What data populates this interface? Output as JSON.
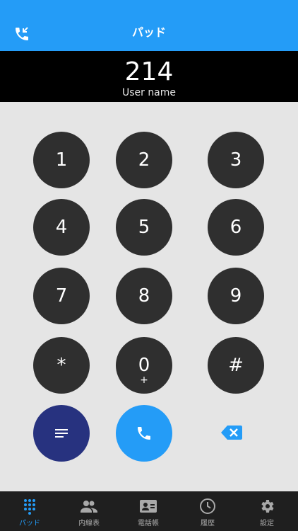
{
  "header": {
    "title": "パッド",
    "left_icon": "incoming-call-icon"
  },
  "display": {
    "number": "214",
    "user_name": "User name"
  },
  "keypad": {
    "keys": [
      {
        "digit": "1",
        "sub": ""
      },
      {
        "digit": "2",
        "sub": ""
      },
      {
        "digit": "3",
        "sub": ""
      },
      {
        "digit": "4",
        "sub": ""
      },
      {
        "digit": "5",
        "sub": ""
      },
      {
        "digit": "6",
        "sub": ""
      },
      {
        "digit": "7",
        "sub": ""
      },
      {
        "digit": "8",
        "sub": ""
      },
      {
        "digit": "9",
        "sub": ""
      },
      {
        "digit": "*",
        "sub": ""
      },
      {
        "digit": "0",
        "sub": "+"
      },
      {
        "digit": "#",
        "sub": ""
      }
    ]
  },
  "actions": {
    "menu_icon": "menu-lines-icon",
    "call_icon": "phone-icon",
    "backspace_icon": "backspace-icon"
  },
  "tabs": [
    {
      "label": "パッド",
      "icon": "dialpad-icon",
      "active": true
    },
    {
      "label": "内線表",
      "icon": "people-icon",
      "active": false
    },
    {
      "label": "電話帳",
      "icon": "contact-card-icon",
      "active": false
    },
    {
      "label": "履歴",
      "icon": "clock-icon",
      "active": false
    },
    {
      "label": "設定",
      "icon": "gear-icon",
      "active": false
    }
  ],
  "colors": {
    "accent": "#249cf7",
    "key": "#2f2f2f",
    "menu": "#27327f",
    "tabbar": "#1f1f1f"
  }
}
